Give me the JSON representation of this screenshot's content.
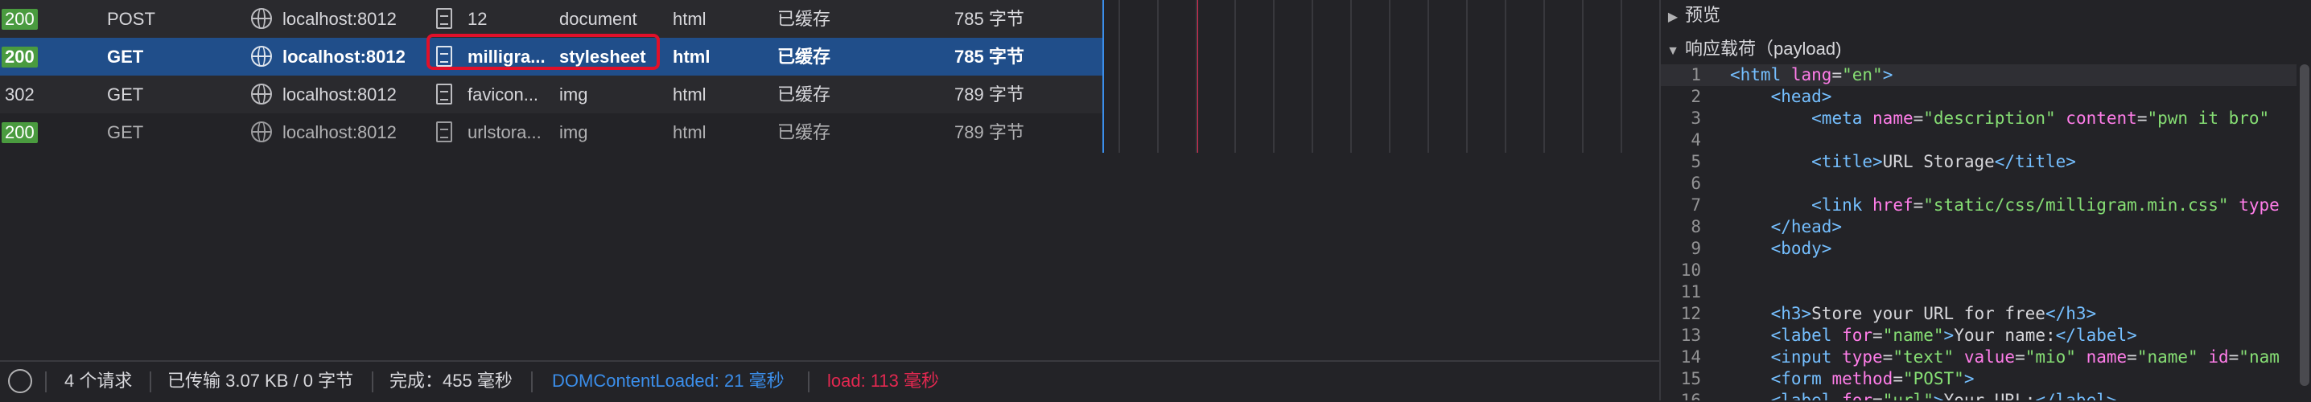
{
  "requests": [
    {
      "status": "200",
      "method": "POST",
      "domain": "localhost:8012",
      "file": "12",
      "type": "document",
      "transfer": "html",
      "cached": "已缓存",
      "size": "785 字节",
      "state": "alt"
    },
    {
      "status": "200",
      "method": "GET",
      "domain": "localhost:8012",
      "file": "milligra...",
      "type": "stylesheet",
      "transfer": "html",
      "cached": "已缓存",
      "size": "785 字节",
      "state": "sel"
    },
    {
      "status": "302",
      "method": "GET",
      "domain": "localhost:8012",
      "file": "favicon...",
      "type": "img",
      "transfer": "html",
      "cached": "已缓存",
      "size": "789 字节",
      "state": "alt"
    },
    {
      "status": "200",
      "method": "GET",
      "domain": "localhost:8012",
      "file": "urlstora...",
      "type": "img",
      "transfer": "html",
      "cached": "已缓存",
      "size": "789 字节",
      "state": "dim"
    }
  ],
  "footer": {
    "requests": "4 个请求",
    "transferred": "已传输 3.07 KB / 0 字节",
    "finish": "完成：455 毫秒",
    "dom_loaded": "DOMContentLoaded: 21 毫秒",
    "load": "load: 113 毫秒",
    "dom_color": "#3b8eea",
    "load_color": "#e22850"
  },
  "panel": {
    "preview_label": "预览",
    "response_label": "响应载荷（payload)"
  },
  "code_lines": [
    {
      "n": "1",
      "html": "<span class=\"tag\">&lt;html</span> <span class=\"attr\">lang</span>=<span class=\"str\">\"en\"</span><span class=\"tag\">&gt;</span>"
    },
    {
      "n": "2",
      "html": "    <span class=\"tag\">&lt;head&gt;</span>"
    },
    {
      "n": "3",
      "html": "        <span class=\"tag\">&lt;meta</span> <span class=\"attr\">name</span>=<span class=\"str\">\"description\"</span> <span class=\"attr\">content</span>=<span class=\"str\">\"pwn it bro\"</span>"
    },
    {
      "n": "4",
      "html": ""
    },
    {
      "n": "5",
      "html": "        <span class=\"tag\">&lt;title&gt;</span>URL Storage<span class=\"tag\">&lt;/title&gt;</span>"
    },
    {
      "n": "6",
      "html": ""
    },
    {
      "n": "7",
      "html": "        <span class=\"tag\">&lt;link</span> <span class=\"attr\">href</span>=<span class=\"str\">\"static/css/milligram.min.css\"</span> <span class=\"attr\">type</span>"
    },
    {
      "n": "8",
      "html": "    <span class=\"tag\">&lt;/head&gt;</span>"
    },
    {
      "n": "9",
      "html": "    <span class=\"tag\">&lt;body&gt;</span>"
    },
    {
      "n": "10",
      "html": ""
    },
    {
      "n": "11",
      "html": ""
    },
    {
      "n": "12",
      "html": "    <span class=\"tag\">&lt;h3&gt;</span>Store your URL for free<span class=\"tag\">&lt;/h3&gt;</span>"
    },
    {
      "n": "13",
      "html": "    <span class=\"tag\">&lt;label</span> <span class=\"attr\">for</span>=<span class=\"str\">\"name\"</span><span class=\"tag\">&gt;</span>Your name:<span class=\"tag\">&lt;/label&gt;</span>"
    },
    {
      "n": "14",
      "html": "    <span class=\"tag\">&lt;input</span> <span class=\"attr\">type</span>=<span class=\"str\">\"text\"</span> <span class=\"attr\">value</span>=<span class=\"str\">\"mio\"</span> <span class=\"attr\">name</span>=<span class=\"str\">\"name\"</span> <span class=\"attr\">id</span>=<span class=\"str\">\"nam</span>"
    },
    {
      "n": "15",
      "html": "    <span class=\"tag\">&lt;form</span> <span class=\"attr\">method</span>=<span class=\"str\">\"POST\"</span><span class=\"tag\">&gt;</span>"
    },
    {
      "n": "16",
      "html": "    <span class=\"tag\">&lt;label</span> <span class=\"attr\">for</span>=<span class=\"str\">\"url\"</span><span class=\"tag\">&gt;</span>Your URL:<span class=\"tag\">&lt;/label&gt;</span>"
    }
  ]
}
